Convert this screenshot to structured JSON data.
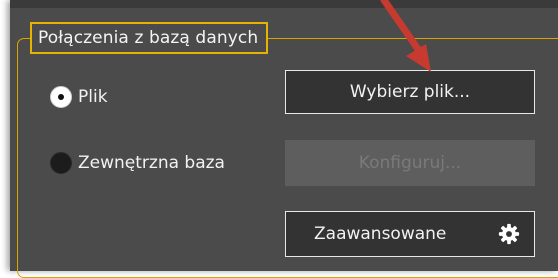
{
  "group": {
    "title": "Połączenia z bazą danych"
  },
  "options": [
    {
      "label": "Plik",
      "checked": true
    },
    {
      "label": "Zewnętrzna baza",
      "checked": false
    }
  ],
  "buttons": {
    "choose_file": "Wybierz plik...",
    "configure": "Konfiguruj...",
    "advanced": "Zaawansowane"
  },
  "icons": {
    "advanced": "gear-icon",
    "annotation": "red-arrow"
  },
  "colors": {
    "group_border": "#e6b400",
    "arrow": "#c73a2f",
    "panel": "#4b4b4b"
  }
}
